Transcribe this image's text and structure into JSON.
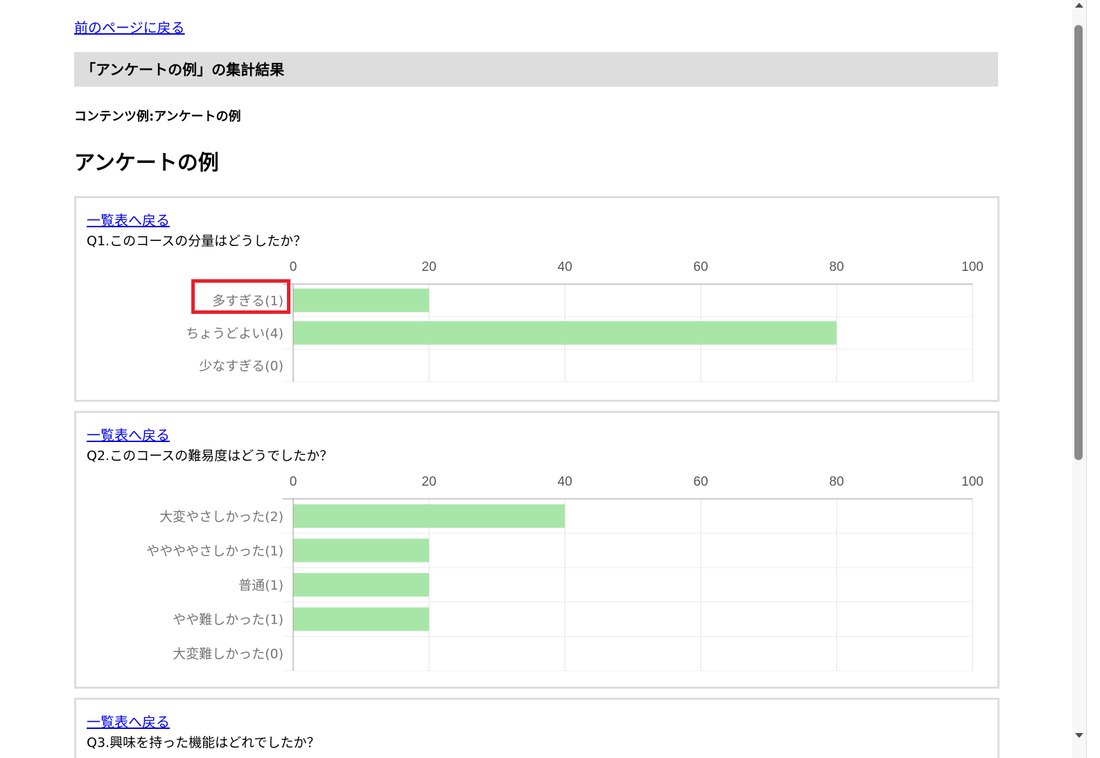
{
  "page": {
    "back_link": "前のページに戻る",
    "title_bar": "「アンケートの例」の集計結果",
    "content_label": "コンテンツ例:アンケートの例",
    "heading": "アンケートの例"
  },
  "questions": [
    {
      "link": "一覧表へ戻る",
      "title": "Q1.このコースの分量はどうしたか？"
    },
    {
      "link": "一覧表へ戻る",
      "title": "Q2.このコースの難易度はどうでしたか？"
    },
    {
      "link": "一覧表へ戻る",
      "title": "Q3.興味を持った機能はどれでしたか？"
    }
  ],
  "colors": {
    "bar": "#a8e6a8",
    "highlight": "#e8202a",
    "link": "#0000ee",
    "title_bar_bg": "#dddddd"
  },
  "chart_data": [
    {
      "type": "bar",
      "orientation": "horizontal",
      "title": "Q1.このコースの分量はどうしたか？",
      "categories": [
        "多すぎる(1)",
        "ちょうどよい(4)",
        "少なすぎる(0)"
      ],
      "values": [
        20,
        80,
        0
      ],
      "xlim": [
        0,
        100
      ],
      "xticks": [
        "0",
        "20",
        "40",
        "60",
        "80",
        "100"
      ],
      "grid": true,
      "axis_position": "top"
    },
    {
      "type": "bar",
      "orientation": "horizontal",
      "title": "Q2.このコースの難易度はどうでしたか？",
      "categories": [
        "大変やさしかった(2)",
        "ややややさしかった(1)",
        "普通(1)",
        "やや難しかった(1)",
        "大変難しかった(0)"
      ],
      "values": [
        40,
        20,
        20,
        20,
        0
      ],
      "xlim": [
        0,
        100
      ],
      "xticks": [
        "0",
        "20",
        "40",
        "60",
        "80",
        "100"
      ],
      "grid": true,
      "axis_position": "top"
    }
  ]
}
